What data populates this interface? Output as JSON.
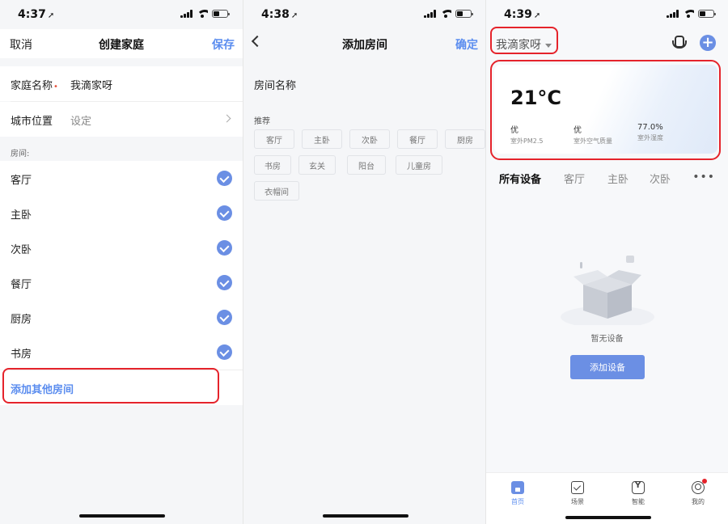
{
  "panel1": {
    "time": "4:37",
    "nav": {
      "cancel": "取消",
      "title": "创建家庭",
      "save": "保存"
    },
    "family_name_label": "家庭名称",
    "family_name_required": "•",
    "family_name_value": "我滴家呀",
    "city_label": "城市位置",
    "city_value": "设定",
    "rooms_section": "房间:",
    "rooms": [
      {
        "name": "客厅",
        "checked": true
      },
      {
        "name": "主卧",
        "checked": true
      },
      {
        "name": "次卧",
        "checked": true
      },
      {
        "name": "餐厅",
        "checked": true
      },
      {
        "name": "厨房",
        "checked": true
      },
      {
        "name": "书房",
        "checked": true
      }
    ],
    "add_other": "添加其他房间"
  },
  "panel2": {
    "time": "4:38",
    "nav": {
      "title": "添加房间",
      "confirm": "确定"
    },
    "room_name_label": "房间名称",
    "recommend_label": "推荐",
    "chips": [
      "客厅",
      "主卧",
      "次卧",
      "餐厅",
      "厨房",
      "书房",
      "玄关",
      "阳台",
      "儿童房",
      "衣帽间"
    ]
  },
  "panel3": {
    "time": "4:39",
    "family": "我滴家呀",
    "weather": {
      "temp": "21°C",
      "metrics": [
        {
          "value": "优",
          "label": "室外PM2.5"
        },
        {
          "value": "优",
          "label": "室外空气质量"
        },
        {
          "value": "77.0%",
          "label": "室外湿度"
        }
      ]
    },
    "tabs": [
      "所有设备",
      "客厅",
      "主卧",
      "次卧"
    ],
    "empty_text": "暂无设备",
    "add_device": "添加设备",
    "tabbar": [
      {
        "label": "首页",
        "icon": "home-icon"
      },
      {
        "label": "场景",
        "icon": "scene-icon"
      },
      {
        "label": "智能",
        "icon": "smart-icon"
      },
      {
        "label": "我的",
        "icon": "profile-icon"
      }
    ]
  },
  "colors": {
    "accent": "#5b8def",
    "highlight": "#e5232b"
  }
}
